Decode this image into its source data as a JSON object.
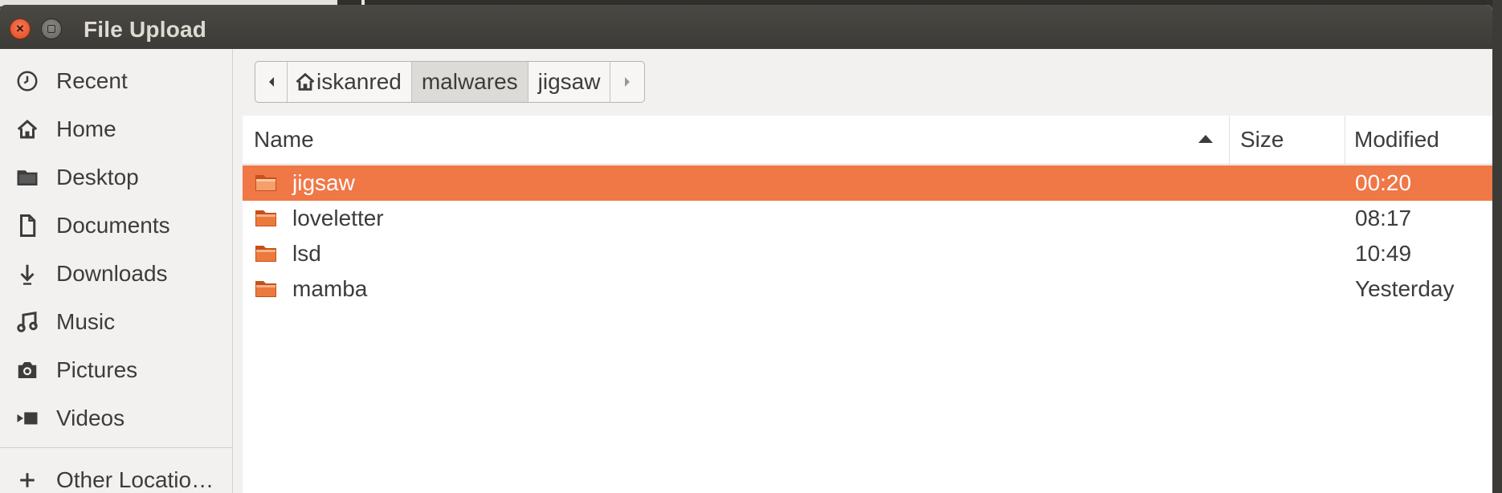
{
  "window": {
    "title": "File Upload"
  },
  "sidebar": {
    "items": [
      {
        "label": "Recent",
        "icon": "clock-icon"
      },
      {
        "label": "Home",
        "icon": "home-icon"
      },
      {
        "label": "Desktop",
        "icon": "folder-icon"
      },
      {
        "label": "Documents",
        "icon": "document-icon"
      },
      {
        "label": "Downloads",
        "icon": "download-icon"
      },
      {
        "label": "Music",
        "icon": "music-icon"
      },
      {
        "label": "Pictures",
        "icon": "camera-icon"
      },
      {
        "label": "Videos",
        "icon": "video-icon"
      }
    ],
    "other_locations": {
      "label": "Other Locatio…",
      "icon": "plus-icon"
    }
  },
  "pathbar": {
    "segments": [
      "iskanred",
      "malwares",
      "jigsaw"
    ]
  },
  "filelist": {
    "columns": {
      "name": "Name",
      "size": "Size",
      "modified": "Modified"
    },
    "rows": [
      {
        "name": "jigsaw",
        "size": "",
        "modified": "00:20",
        "selected": true
      },
      {
        "name": "loveletter",
        "size": "",
        "modified": "08:17",
        "selected": false
      },
      {
        "name": "lsd",
        "size": "",
        "modified": "10:49",
        "selected": false
      },
      {
        "name": "mamba",
        "size": "",
        "modified": "Yesterday",
        "selected": false
      }
    ]
  },
  "colors": {
    "accent": "#f07746",
    "titlebar": "#3c3b37",
    "close_button": "#df4a1f",
    "folder": "#e36a2c"
  }
}
